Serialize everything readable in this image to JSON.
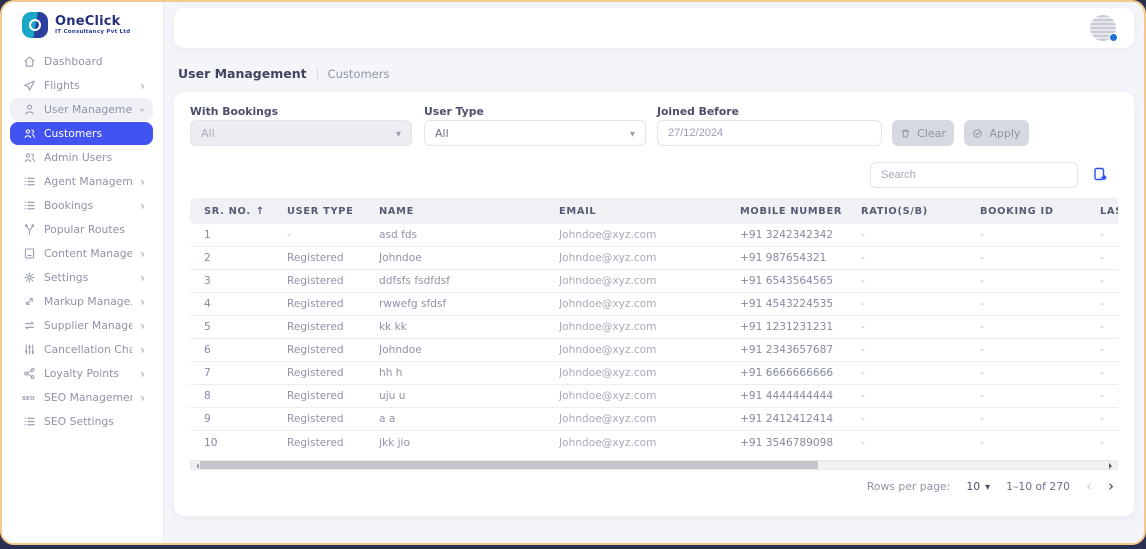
{
  "brand": {
    "name": "OneClick",
    "tagline": "IT Consultancy Pvt Ltd"
  },
  "sidebar": {
    "items": [
      {
        "label": "Dashboard",
        "icon": "dashboard-icon"
      },
      {
        "label": "Flights",
        "icon": "flights-icon",
        "chevron": "right"
      },
      {
        "label": "User Management",
        "icon": "user-icon",
        "chevron": "down",
        "state": "expanded"
      },
      {
        "label": "Customers",
        "icon": "customers-icon",
        "state": "active",
        "child": true
      },
      {
        "label": "Admin Users",
        "icon": "admin-users-icon",
        "child": true
      },
      {
        "label": "Agent Managem...",
        "icon": "agent-icon",
        "chevron": "right"
      },
      {
        "label": "Bookings",
        "icon": "bookings-icon",
        "chevron": "right"
      },
      {
        "label": "Popular Routes",
        "icon": "routes-icon"
      },
      {
        "label": "Content Manage...",
        "icon": "content-icon",
        "chevron": "right"
      },
      {
        "label": "Settings",
        "icon": "settings-icon",
        "chevron": "right"
      },
      {
        "label": "Markup Manage...",
        "icon": "markup-icon",
        "chevron": "right"
      },
      {
        "label": "Supplier Manage...",
        "icon": "supplier-icon",
        "chevron": "right"
      },
      {
        "label": "Cancellation Char...",
        "icon": "cancellation-icon",
        "chevron": "right"
      },
      {
        "label": "Loyalty Points",
        "icon": "loyalty-icon",
        "chevron": "right"
      },
      {
        "label": "SEO Management",
        "icon": "seo-icon",
        "chevron": "right"
      },
      {
        "label": "SEO Settings",
        "icon": "seo-settings-icon"
      }
    ]
  },
  "breadcrumb": {
    "section": "User Management",
    "page": "Customers"
  },
  "filters": {
    "with_bookings": {
      "label": "With Bookings",
      "value": "All",
      "disabled": true
    },
    "user_type": {
      "label": "User Type",
      "value": "All",
      "disabled": false
    },
    "joined_before": {
      "label": "Joined Before",
      "value": "27/12/2024"
    },
    "clear_label": "Clear",
    "apply_label": "Apply"
  },
  "search": {
    "placeholder": "Search"
  },
  "table": {
    "columns": [
      "SR. NO.",
      "USER TYPE",
      "NAME",
      "EMAIL",
      "MOBILE NUMBER",
      "RATIO(S/B)",
      "BOOKING ID",
      "LAS"
    ],
    "sort_column_index": 0,
    "sort_direction": "asc",
    "rows": [
      [
        "1",
        "-",
        "asd fds",
        "Johndoe@xyz.com",
        "+91 3242342342",
        "-",
        "-",
        "-"
      ],
      [
        "2",
        "Registered",
        "Johndoe",
        "Johndoe@xyz.com",
        "+91 987654321",
        "-",
        "-",
        "-"
      ],
      [
        "3",
        "Registered",
        "ddfsfs fsdfdsf",
        "Johndoe@xyz.com",
        "+91 6543564565",
        "-",
        "-",
        "-"
      ],
      [
        "4",
        "Registered",
        "rwwefg sfdsf",
        "Johndoe@xyz.com",
        "+91 4543224535",
        "-",
        "-",
        "-"
      ],
      [
        "5",
        "Registered",
        "kk kk",
        "Johndoe@xyz.com",
        "+91 1231231231",
        "-",
        "-",
        "-"
      ],
      [
        "6",
        "Registered",
        "Johndoe",
        "Johndoe@xyz.com",
        "+91 2343657687",
        "-",
        "-",
        "-"
      ],
      [
        "7",
        "Registered",
        "hh h",
        "Johndoe@xyz.com",
        "+91 6666666666",
        "-",
        "-",
        "-"
      ],
      [
        "8",
        "Registered",
        "uju u",
        "Johndoe@xyz.com",
        "+91 4444444444",
        "-",
        "-",
        "-"
      ],
      [
        "9",
        "Registered",
        "a a",
        "Johndoe@xyz.com",
        "+91 2412412414",
        "-",
        "-",
        "-"
      ],
      [
        "10",
        "Registered",
        "jkk jio",
        "Johndoe@xyz.com",
        "+91 3546789098",
        "-",
        "-",
        "-"
      ]
    ]
  },
  "pagination": {
    "rows_per_page_label": "Rows per page:",
    "rows_per_page": "10",
    "range": "1–10 of 270"
  },
  "colors": {
    "accent": "#4154f1",
    "frame_border": "#f4c98e",
    "export_icon": "#2b4ff0",
    "status_dot": "#1f6fd6"
  }
}
